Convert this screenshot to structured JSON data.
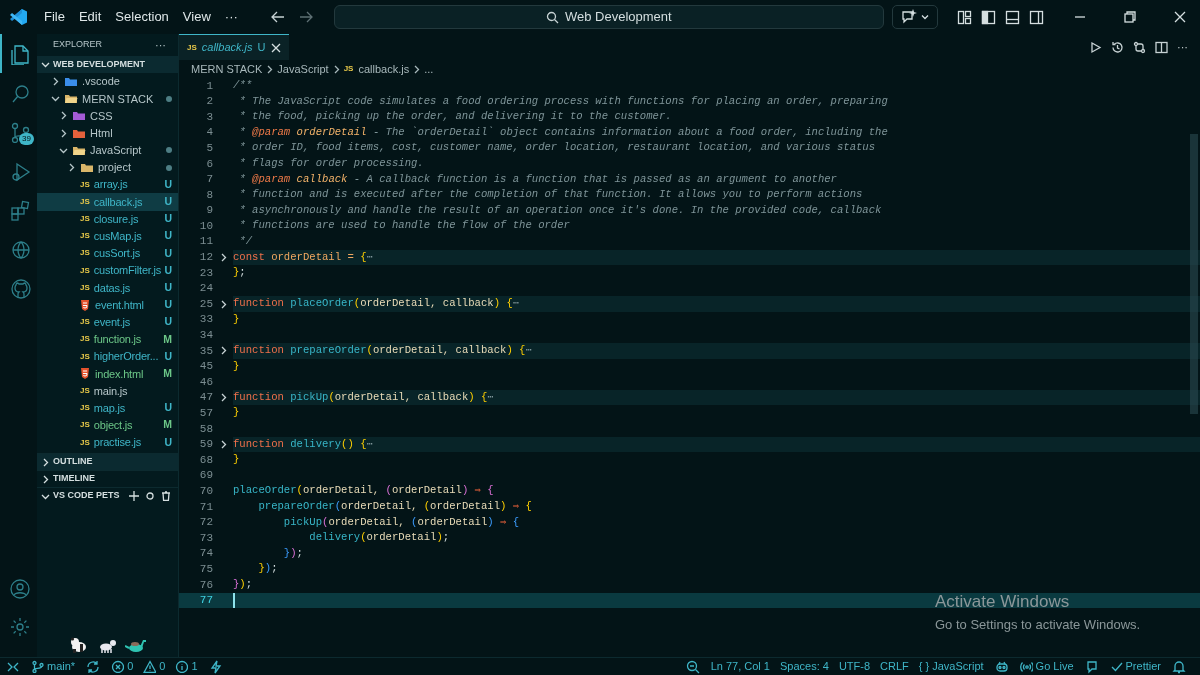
{
  "title_bar": {
    "menu": [
      "File",
      "Edit",
      "Selection",
      "View",
      "···"
    ],
    "search": {
      "value": "Web Development"
    }
  },
  "activity_bar": {
    "top": [
      {
        "kind": "files",
        "selected": true
      },
      {
        "kind": "search",
        "selected": false
      },
      {
        "kind": "source-control",
        "selected": false,
        "badge": "39"
      },
      {
        "kind": "run",
        "selected": false
      },
      {
        "kind": "extensions",
        "selected": false
      },
      {
        "kind": "remote",
        "selected": false
      },
      {
        "kind": "github",
        "selected": false
      }
    ],
    "bottom": [
      {
        "kind": "account"
      },
      {
        "kind": "settings"
      }
    ]
  },
  "explorer": {
    "title": "EXPLORER",
    "more": "···",
    "folder": "WEB DEVELOPMENT",
    "tree": [
      {
        "label": ".vscode",
        "kind": "vscode-folder",
        "expanded": false,
        "selected": false,
        "changes": false
      },
      {
        "label": "MERN STACK",
        "kind": "folder",
        "expanded": true,
        "selected": false,
        "changes": true,
        "children": [
          {
            "label": "CSS",
            "kind": "css-folder",
            "expanded": false,
            "selected": false,
            "changes": false
          },
          {
            "label": "Html",
            "kind": "html-folder",
            "expanded": false,
            "selected": false,
            "changes": false
          },
          {
            "label": "JavaScript",
            "kind": "folder",
            "expanded": true,
            "selected": false,
            "changes": true,
            "children": [
              {
                "label": "project",
                "kind": "folder",
                "expanded": false,
                "selected": false,
                "changes": true
              },
              {
                "label": "array.js",
                "kind": "js-file",
                "icon_text": "JS",
                "badge": "U",
                "color": "#3fb6c8",
                "selected": false
              },
              {
                "label": "callback.js",
                "kind": "js-file",
                "icon_text": "JS",
                "badge": "U",
                "color": "#3fb6c8",
                "selected": true
              },
              {
                "label": "closure.js",
                "kind": "js-file",
                "icon_text": "JS",
                "badge": "U",
                "color": "#3fb6c8",
                "selected": false
              },
              {
                "label": "cusMap.js",
                "kind": "js-file",
                "icon_text": "JS",
                "badge": "U",
                "color": "#3fb6c8",
                "selected": false
              },
              {
                "label": "cusSort.js",
                "kind": "js-file",
                "icon_text": "JS",
                "badge": "U",
                "color": "#3fb6c8",
                "selected": false
              },
              {
                "label": "customFilter.js",
                "kind": "js-file",
                "icon_text": "JS",
                "badge": "U",
                "color": "#3fb6c8",
                "selected": false
              },
              {
                "label": "datas.js",
                "kind": "js-file",
                "icon_text": "JS",
                "badge": "U",
                "color": "#3fb6c8",
                "selected": false
              },
              {
                "label": "event.html",
                "kind": "html-file",
                "badge": "U",
                "color": "#3fb6c8",
                "selected": false
              },
              {
                "label": "event.js",
                "kind": "js-file",
                "icon_text": "JS",
                "badge": "U",
                "color": "#3fb6c8",
                "selected": false
              },
              {
                "label": "function.js",
                "kind": "js-file",
                "icon_text": "JS",
                "badge": "M",
                "color": "#6cc788",
                "selected": false
              },
              {
                "label": "higherOrder...",
                "kind": "js-file",
                "icon_text": "JS",
                "badge": "U",
                "color": "#3fb6c8",
                "selected": false
              },
              {
                "label": "index.html",
                "kind": "html-file",
                "badge": "M",
                "color": "#6cc788",
                "selected": false
              },
              {
                "label": "main.js",
                "kind": "js-file",
                "icon_text": "JS",
                "color": "#b6c6c9",
                "selected": false
              },
              {
                "label": "map.js",
                "kind": "js-file",
                "icon_text": "JS",
                "badge": "U",
                "color": "#3fb6c8",
                "selected": false
              },
              {
                "label": "object.js",
                "kind": "js-file",
                "icon_text": "JS",
                "badge": "M",
                "color": "#6cc788",
                "selected": false
              },
              {
                "label": "practise.js",
                "kind": "js-file",
                "icon_text": "JS",
                "badge": "U",
                "color": "#3fb6c8",
                "selected": false
              }
            ]
          }
        ]
      }
    ],
    "sections": [
      {
        "label": "OUTLINE",
        "expanded": false,
        "actions": false
      },
      {
        "label": "TIMELINE",
        "expanded": false,
        "actions": false
      },
      {
        "label": "VS CODE PETS",
        "expanded": true,
        "actions": true
      }
    ]
  },
  "editor": {
    "tab": {
      "icon_text": "JS",
      "label": "callback.js",
      "badge": "U",
      "selected": true
    },
    "breadcrumbs": [
      {
        "text": "MERN STACK"
      },
      {
        "text": "JavaScript"
      },
      {
        "text": "callback.js",
        "icon_text": "JS"
      },
      {
        "text": "..."
      }
    ],
    "lines": [
      {
        "n": "1",
        "tokens": [
          {
            "kind": "c",
            "text": "/**"
          }
        ]
      },
      {
        "n": "2",
        "tokens": [
          {
            "kind": "c",
            "text": " * The JavaScript code simulates a food ordering process with functions for placing an order, preparing"
          }
        ]
      },
      {
        "n": "3",
        "tokens": [
          {
            "kind": "c",
            "text": " * the food, picking up the order, and delivering it to the customer."
          }
        ]
      },
      {
        "n": "4",
        "tokens": [
          {
            "kind": "c",
            "text": " * "
          },
          {
            "kind": "tag",
            "text": "@param"
          },
          {
            "kind": "docparam",
            "text": " orderDetail"
          },
          {
            "kind": "c",
            "text": " - The `orderDetail` object contains information about a food order, including the"
          }
        ]
      },
      {
        "n": "5",
        "tokens": [
          {
            "kind": "c",
            "text": " * order ID, food items, cost, customer name, order location, restaurant location, and various status"
          }
        ]
      },
      {
        "n": "6",
        "tokens": [
          {
            "kind": "c",
            "text": " * flags for order processing."
          }
        ]
      },
      {
        "n": "7",
        "tokens": [
          {
            "kind": "c",
            "text": " * "
          },
          {
            "kind": "tag",
            "text": "@param"
          },
          {
            "kind": "docparam",
            "text": " callback"
          },
          {
            "kind": "c",
            "text": " - A callback function is a function that is passed as an argument to another"
          }
        ]
      },
      {
        "n": "8",
        "tokens": [
          {
            "kind": "c",
            "text": " * function and is executed after the completion of that function. It allows you to perform actions"
          }
        ]
      },
      {
        "n": "9",
        "tokens": [
          {
            "kind": "c",
            "text": " * asynchronously and handle the result of an operation once it's done. In the provided code, callback"
          }
        ]
      },
      {
        "n": "10",
        "tokens": [
          {
            "kind": "c",
            "text": " * functions are used to handle the flow of the order"
          }
        ]
      },
      {
        "n": "11",
        "tokens": [
          {
            "kind": "c",
            "text": " */"
          }
        ]
      },
      {
        "n": "12",
        "folded": true,
        "tokens": [
          {
            "kind": "kw",
            "text": "const"
          },
          {
            "kind": "var",
            "text": " orderDetail"
          },
          {
            "kind": "op",
            "text": " ="
          },
          {
            "kind": "b1",
            "text": " {"
          },
          {
            "kind": "ell",
            "text": "⋯"
          }
        ]
      },
      {
        "n": "23",
        "tokens": [
          {
            "kind": "b1",
            "text": "}"
          },
          {
            "kind": "p",
            "text": ";"
          }
        ]
      },
      {
        "n": "24"
      },
      {
        "n": "25",
        "folded": true,
        "tokens": [
          {
            "kind": "kw",
            "text": "function"
          },
          {
            "kind": "fn",
            "text": " placeOrder"
          },
          {
            "kind": "b1",
            "text": "("
          },
          {
            "kind": "arg",
            "text": "orderDetail, callback"
          },
          {
            "kind": "b1",
            "text": ") {"
          },
          {
            "kind": "ell",
            "text": "⋯"
          }
        ]
      },
      {
        "n": "33",
        "tokens": [
          {
            "kind": "b1",
            "text": "}"
          }
        ]
      },
      {
        "n": "34"
      },
      {
        "n": "35",
        "folded": true,
        "tokens": [
          {
            "kind": "kw",
            "text": "function"
          },
          {
            "kind": "fn",
            "text": " prepareOrder"
          },
          {
            "kind": "b1",
            "text": "("
          },
          {
            "kind": "arg",
            "text": "orderDetail, callback"
          },
          {
            "kind": "b1",
            "text": ") {"
          },
          {
            "kind": "ell",
            "text": "⋯"
          }
        ]
      },
      {
        "n": "45",
        "tokens": [
          {
            "kind": "b1",
            "text": "}"
          }
        ]
      },
      {
        "n": "46"
      },
      {
        "n": "47",
        "folded": true,
        "tokens": [
          {
            "kind": "kw",
            "text": "function"
          },
          {
            "kind": "fn",
            "text": " pickUp"
          },
          {
            "kind": "b1",
            "text": "("
          },
          {
            "kind": "arg",
            "text": "orderDetail, callback"
          },
          {
            "kind": "b1",
            "text": ") {"
          },
          {
            "kind": "ell",
            "text": "⋯"
          }
        ]
      },
      {
        "n": "57",
        "tokens": [
          {
            "kind": "b1",
            "text": "}"
          }
        ]
      },
      {
        "n": "58"
      },
      {
        "n": "59",
        "folded": true,
        "tokens": [
          {
            "kind": "kw",
            "text": "function"
          },
          {
            "kind": "fn",
            "text": " delivery"
          },
          {
            "kind": "b1",
            "text": "() {"
          },
          {
            "kind": "ell",
            "text": "⋯"
          }
        ]
      },
      {
        "n": "68",
        "tokens": [
          {
            "kind": "b1",
            "text": "}"
          }
        ]
      },
      {
        "n": "69"
      },
      {
        "n": "70",
        "tokens": [
          {
            "kind": "fn",
            "text": "placeOrder"
          },
          {
            "kind": "b1",
            "text": "("
          },
          {
            "kind": "arg",
            "text": "orderDetail, "
          },
          {
            "kind": "b2",
            "text": "("
          },
          {
            "kind": "arg",
            "text": "orderDetail"
          },
          {
            "kind": "b2",
            "text": ")"
          },
          {
            "kind": "arrow",
            "text": " ⇒"
          },
          {
            "kind": "b2",
            "text": " {"
          }
        ]
      },
      {
        "n": "71",
        "tokens": [
          {
            "kind": "fn",
            "text": "    prepareOrder"
          },
          {
            "kind": "b3",
            "text": "("
          },
          {
            "kind": "arg",
            "text": "orderDetail, "
          },
          {
            "kind": "b1",
            "text": "("
          },
          {
            "kind": "arg",
            "text": "orderDetail"
          },
          {
            "kind": "b1",
            "text": ")"
          },
          {
            "kind": "arrow",
            "text": " ⇒"
          },
          {
            "kind": "b1",
            "text": " {"
          }
        ]
      },
      {
        "n": "72",
        "tokens": [
          {
            "kind": "fn",
            "text": "        pickUp"
          },
          {
            "kind": "b2",
            "text": "("
          },
          {
            "kind": "arg",
            "text": "orderDetail, "
          },
          {
            "kind": "b3",
            "text": "("
          },
          {
            "kind": "arg",
            "text": "orderDetail"
          },
          {
            "kind": "b3",
            "text": ")"
          },
          {
            "kind": "arrow",
            "text": " ⇒"
          },
          {
            "kind": "b3",
            "text": " {"
          }
        ]
      },
      {
        "n": "73",
        "tokens": [
          {
            "kind": "fn",
            "text": "            delivery"
          },
          {
            "kind": "b1",
            "text": "("
          },
          {
            "kind": "arg",
            "text": "orderDetail"
          },
          {
            "kind": "b1",
            "text": ")"
          },
          {
            "kind": "p",
            "text": ";"
          }
        ]
      },
      {
        "n": "74",
        "tokens": [
          {
            "kind": "b3",
            "text": "        }"
          },
          {
            "kind": "b2",
            "text": ")"
          },
          {
            "kind": "p",
            "text": ";"
          }
        ]
      },
      {
        "n": "75",
        "tokens": [
          {
            "kind": "b1",
            "text": "    }"
          },
          {
            "kind": "b3",
            "text": ")"
          },
          {
            "kind": "p",
            "text": ";"
          }
        ]
      },
      {
        "n": "76",
        "tokens": [
          {
            "kind": "b2",
            "text": "}"
          },
          {
            "kind": "b1",
            "text": ")"
          },
          {
            "kind": "p",
            "text": ";"
          }
        ]
      },
      {
        "n": "77",
        "current": true
      }
    ]
  },
  "activation_notice": {
    "title": "Activate Windows",
    "text": "Go to Settings to activate Windows."
  },
  "status_bar": {
    "left": [
      {
        "kind": "remote"
      },
      {
        "kind": "branch",
        "text": "main*"
      },
      {
        "kind": "sync"
      },
      {
        "kind": "error",
        "text": "0"
      },
      {
        "kind": "warning",
        "text": "0"
      },
      {
        "kind": "info",
        "text": "1"
      },
      {
        "kind": "bolt"
      }
    ],
    "right": [
      {
        "kind": "zoom"
      },
      {
        "kind": "plain",
        "text": "Ln 77, Col 1"
      },
      {
        "kind": "plain",
        "text": "Spaces: 4"
      },
      {
        "kind": "plain",
        "text": "UTF-8"
      },
      {
        "kind": "plain",
        "text": "CRLF"
      },
      {
        "kind": "plain",
        "text": "{ } JavaScript"
      },
      {
        "kind": "copilot"
      },
      {
        "kind": "broadcast",
        "text": "Go Live"
      },
      {
        "kind": "feedback"
      },
      {
        "kind": "check",
        "text": "Prettier"
      },
      {
        "kind": "bell"
      }
    ]
  }
}
